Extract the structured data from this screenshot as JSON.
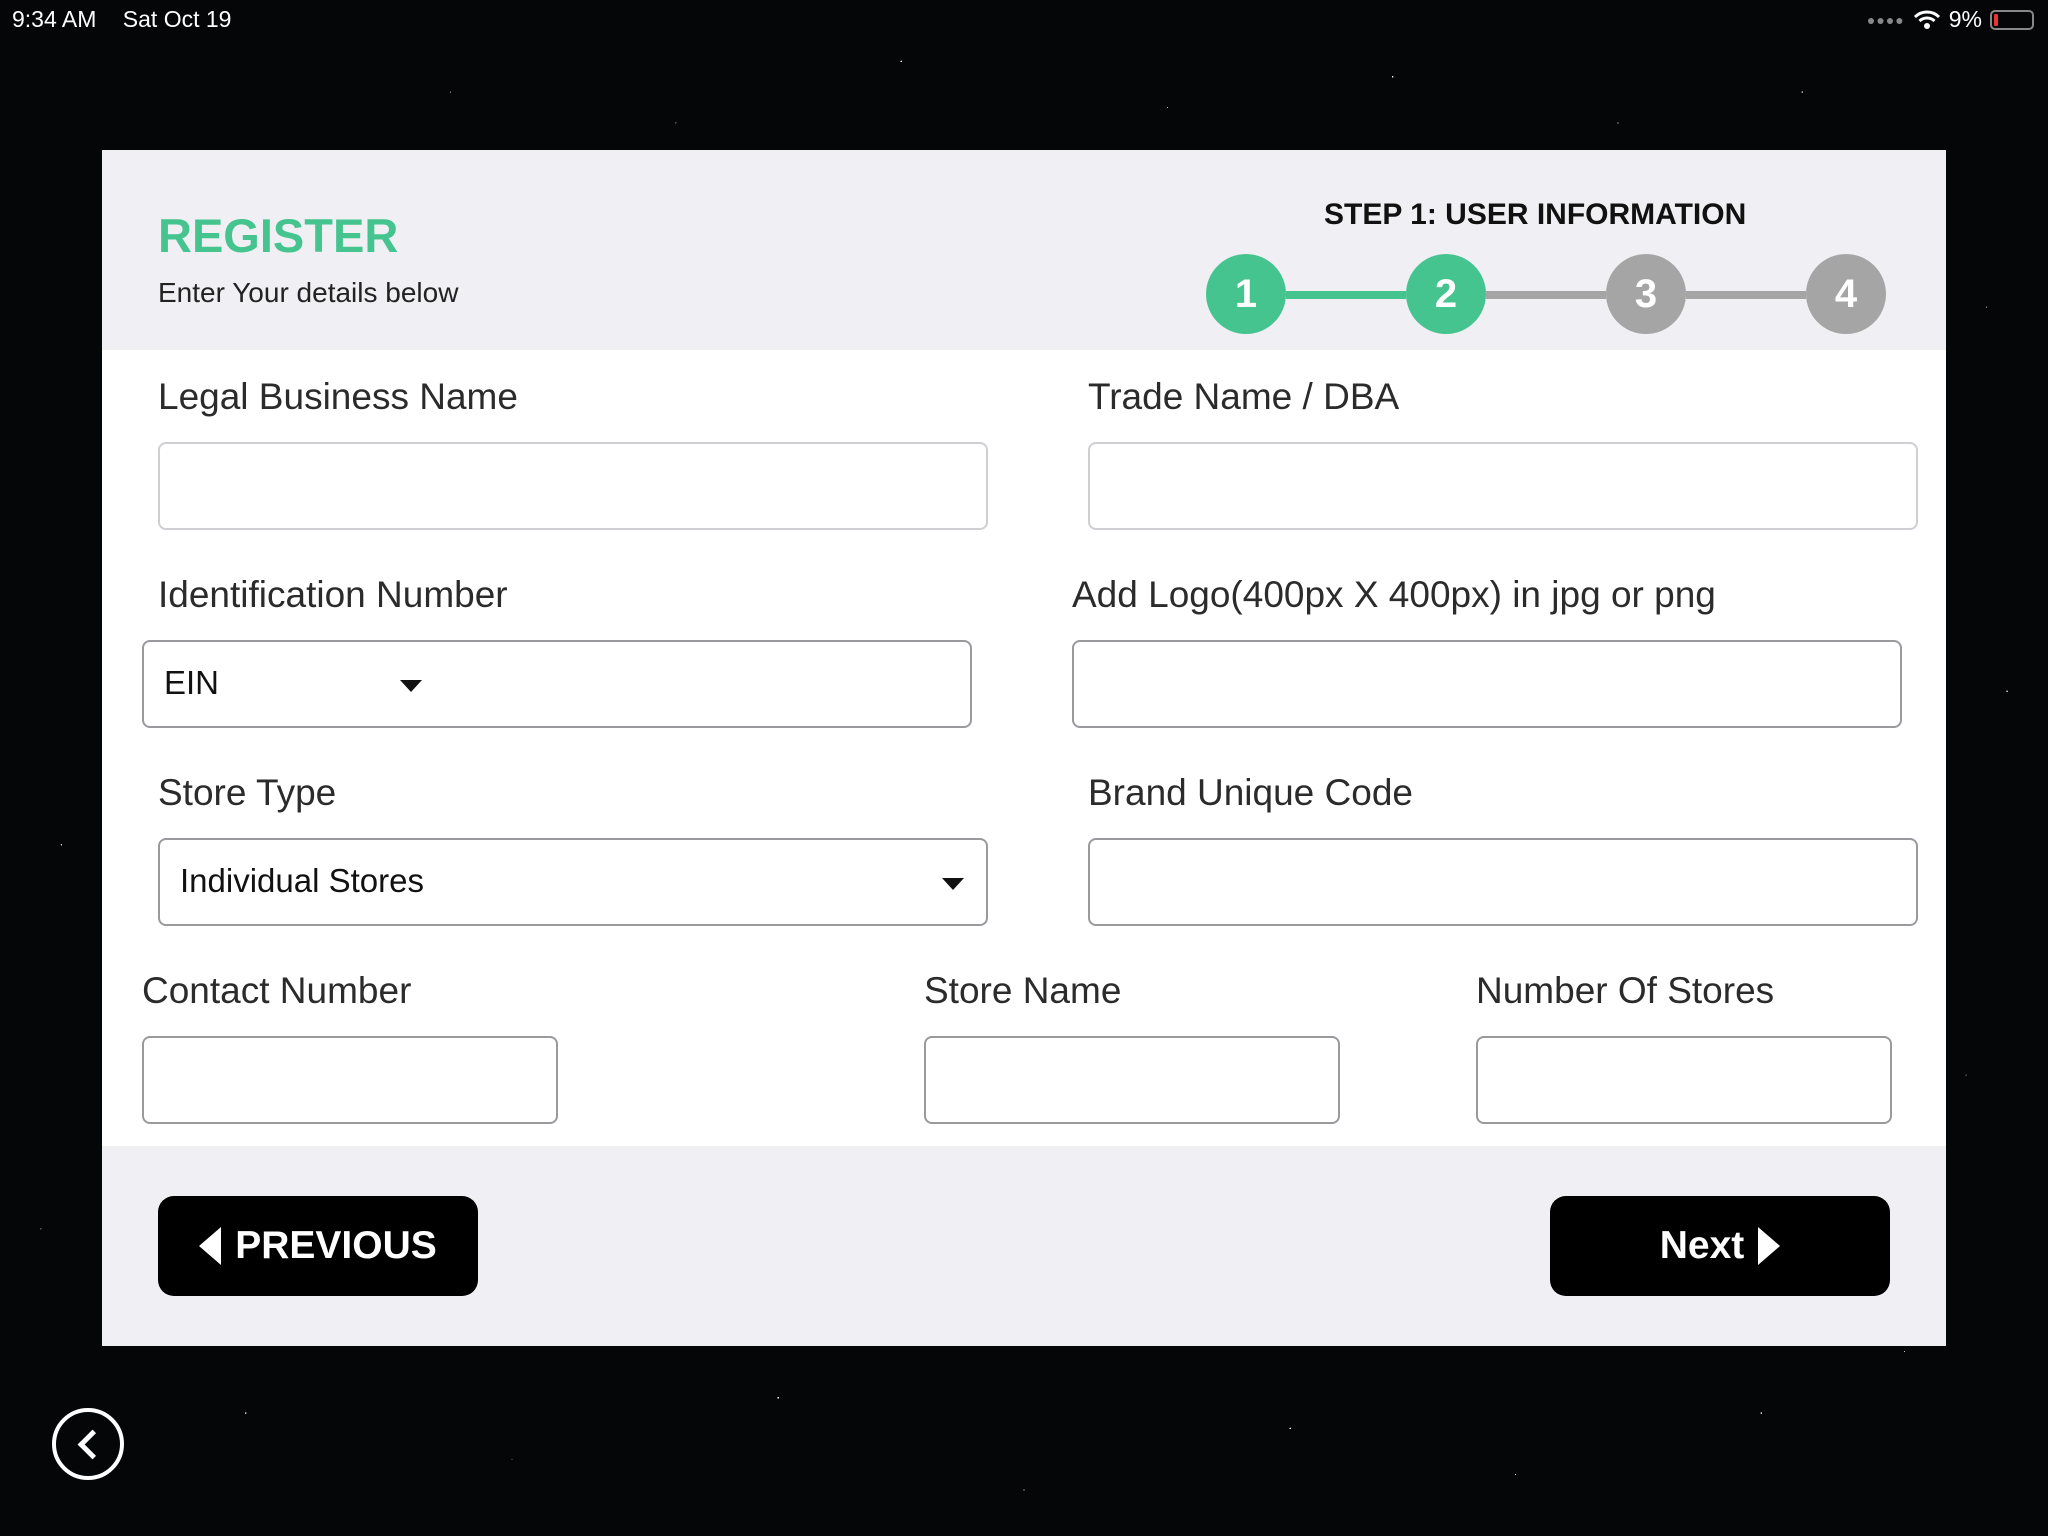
{
  "status_bar": {
    "time": "9:34 AM",
    "date": "Sat Oct 19",
    "battery": "9%"
  },
  "header": {
    "title": "REGISTER",
    "subtitle": "Enter Your details below",
    "step_label": "STEP 1: USER INFORMATION",
    "steps": [
      "1",
      "2",
      "3",
      "4"
    ],
    "active_steps": 2
  },
  "form": {
    "legal_business_name_label": "Legal Business Name",
    "trade_name_label": "Trade Name / DBA",
    "identification_number_label": "Identification Number",
    "identification_type_value": "EIN",
    "logo_label": "Add Logo(400px X 400px) in jpg or png",
    "store_type_label": "Store Type",
    "store_type_value": "Individual Stores",
    "brand_code_label": "Brand Unique Code",
    "contact_number_label": "Contact Number",
    "store_name_label": "Store Name",
    "number_of_stores_label": "Number Of Stores"
  },
  "footer": {
    "previous_label": "PREVIOUS",
    "next_label": "Next"
  },
  "colors": {
    "accent": "#46c48f",
    "inactive_step": "#a5a5a5",
    "panel": "#efeff4",
    "button": "#000000"
  }
}
